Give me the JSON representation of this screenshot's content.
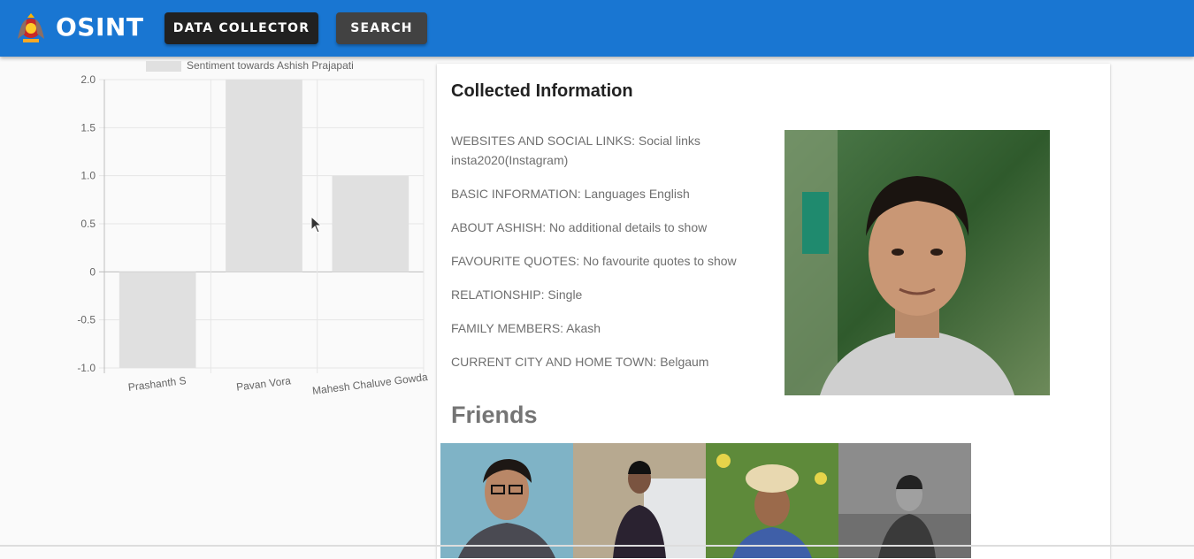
{
  "header": {
    "brand": "OSINT",
    "buttons": {
      "data_collector": "DATA COLLECTOR",
      "search": "SEARCH"
    },
    "colors": {
      "appbar": "#1976d2",
      "collector_btn": "#212121",
      "search_btn": "#424242"
    }
  },
  "chart_data": {
    "type": "bar",
    "legend": "Sentiment towards Ashish Prajapati",
    "legend_position": "top",
    "categories": [
      "Prashanth S",
      "Pavan Vora",
      "Mahesh Chaluve Gowda"
    ],
    "values": [
      -1.0,
      2.0,
      1.0
    ],
    "ylim": [
      -1.0,
      2.0
    ],
    "yticks": [
      "2.0",
      "1.5",
      "1.0",
      "0.5",
      "0",
      "-0.5",
      "-1.0"
    ],
    "grid": true,
    "bar_color": "#e0e0e0"
  },
  "card": {
    "title": "Collected Information",
    "items": [
      "WEBSITES AND SOCIAL LINKS: Social links insta2020(Instagram)",
      "BASIC INFORMATION: Languages English",
      "ABOUT ASHISH: No additional details to show",
      "FAVOURITE QUOTES: No favourite quotes to show",
      "RELATIONSHIP: Single",
      "FAMILY MEMBERS: Akash",
      "CURRENT CITY AND HOME TOWN: Belgaum"
    ],
    "friends_title": "Friends"
  }
}
